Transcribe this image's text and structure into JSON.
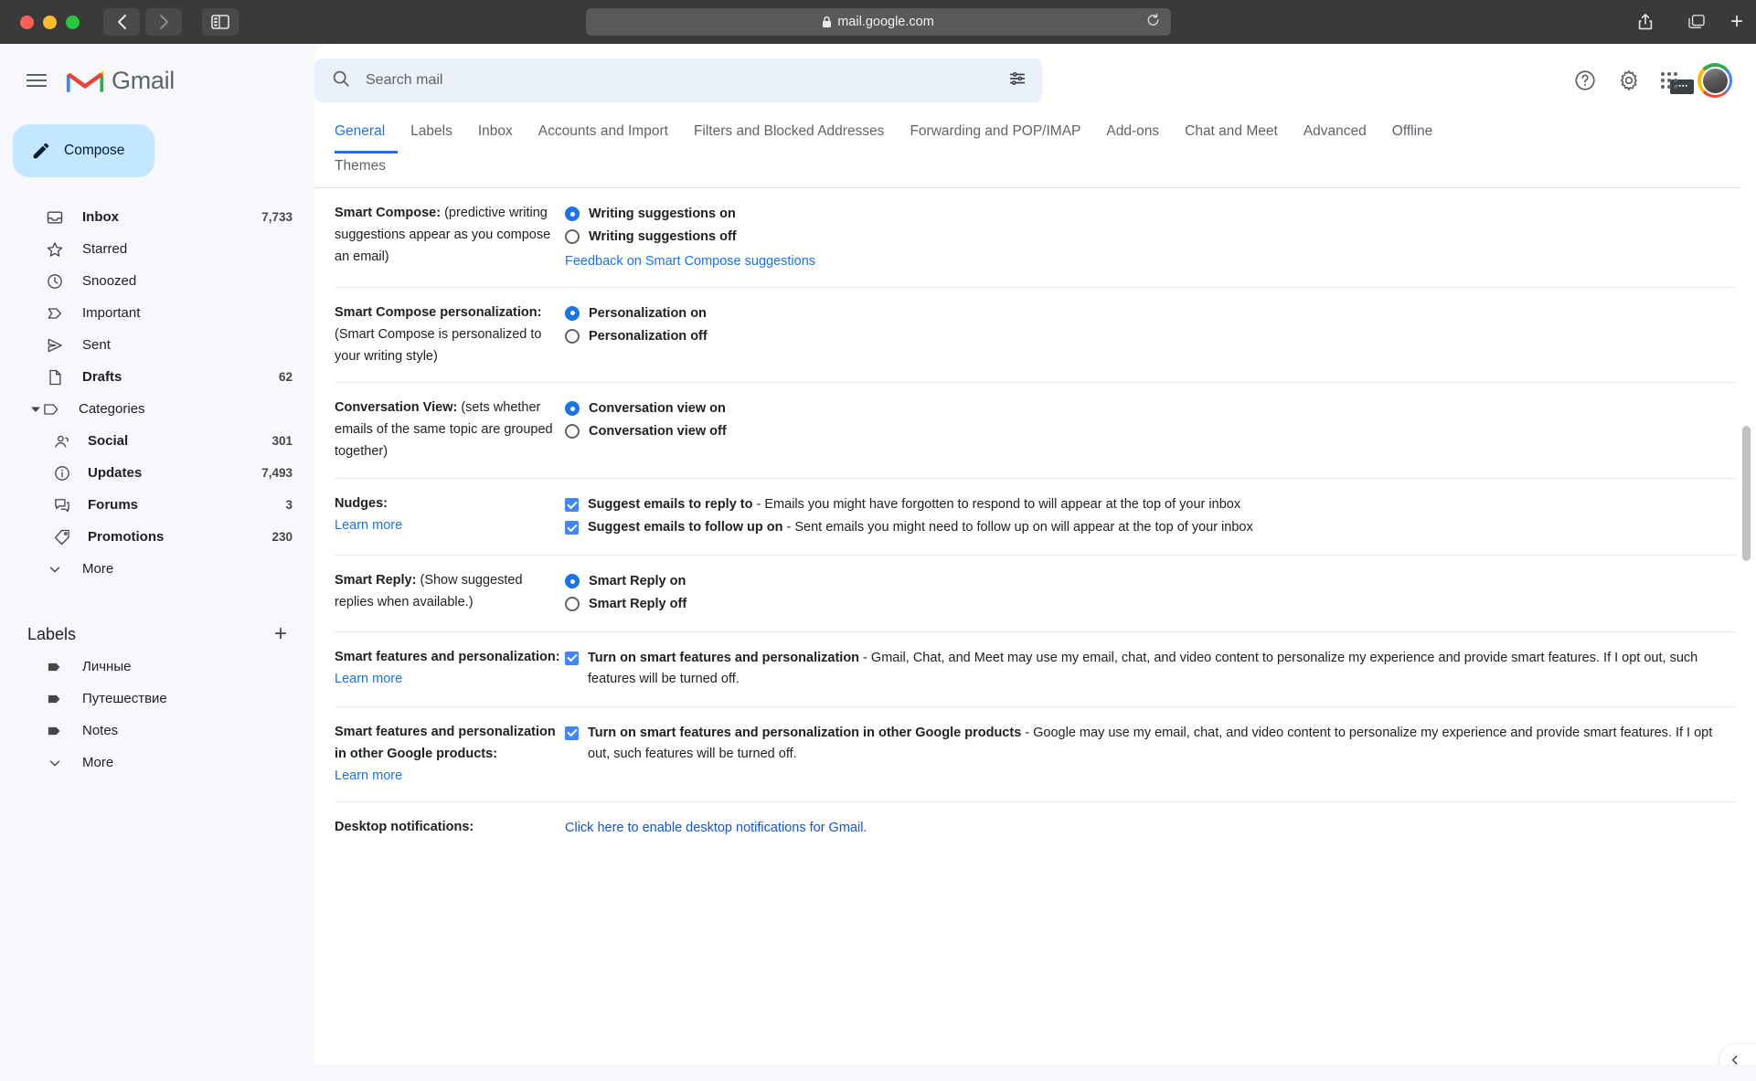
{
  "browser": {
    "url": "mail.google.com",
    "lock_icon": "lock-icon",
    "back_icon": "chevron-left-icon",
    "forward_icon": "chevron-right-icon",
    "sidebar_icon": "sidebar-toggle-icon",
    "share_icon": "share-icon",
    "tabs_icon": "tab-overview-icon",
    "new_tab_icon": "plus-icon",
    "reload_icon": "reload-icon"
  },
  "app": {
    "brand": "Gmail",
    "menu_icon": "hamburger-icon",
    "compose_label": "Compose",
    "compose_icon": "pencil-icon"
  },
  "search": {
    "placeholder": "Search mail",
    "search_icon": "search-icon",
    "options_icon": "search-options-icon"
  },
  "header": {
    "help_icon": "help-icon",
    "settings_icon": "gear-icon",
    "apps_icon": "app-grid-icon",
    "avatar": "avatar"
  },
  "sidebar": {
    "items": [
      {
        "label": "Inbox",
        "count": "7,733",
        "icon": "inbox-icon",
        "bold": true
      },
      {
        "label": "Starred",
        "count": "",
        "icon": "star-icon",
        "bold": false
      },
      {
        "label": "Snoozed",
        "count": "",
        "icon": "clock-icon",
        "bold": false
      },
      {
        "label": "Important",
        "count": "",
        "icon": "important-marker-icon",
        "bold": false
      },
      {
        "label": "Sent",
        "count": "",
        "icon": "send-icon",
        "bold": false
      },
      {
        "label": "Drafts",
        "count": "62",
        "icon": "draft-file-icon",
        "bold": true
      },
      {
        "label": "Categories",
        "count": "",
        "icon": "label-tag-icon",
        "bold": false,
        "expandable": true
      },
      {
        "label": "Social",
        "count": "301",
        "icon": "people-icon",
        "bold": true,
        "sub": true
      },
      {
        "label": "Updates",
        "count": "7,493",
        "icon": "info-icon",
        "bold": true,
        "sub": true
      },
      {
        "label": "Forums",
        "count": "3",
        "icon": "forum-icon",
        "bold": true,
        "sub": true
      },
      {
        "label": "Promotions",
        "count": "230",
        "icon": "price-tag-icon",
        "bold": true,
        "sub": true
      },
      {
        "label": "More",
        "count": "",
        "icon": "chevron-down-icon",
        "bold": false
      }
    ],
    "labels_title": "Labels",
    "add_label_icon": "plus-icon",
    "labels": [
      {
        "label": "Личные",
        "icon": "label-icon"
      },
      {
        "label": "Путешествие",
        "icon": "label-icon"
      },
      {
        "label": "Notes",
        "icon": "label-icon"
      },
      {
        "label": "More",
        "icon": "chevron-down-icon"
      }
    ]
  },
  "settings": {
    "title": "Settings",
    "keyboard_icon": "keyboard-icon",
    "keyboard_caret_icon": "chevron-down-icon",
    "tabs_row1": [
      "General",
      "Labels",
      "Inbox",
      "Accounts and Import",
      "Filters and Blocked Addresses",
      "Forwarding and POP/IMAP",
      "Add-ons",
      "Chat and Meet",
      "Advanced",
      "Offline"
    ],
    "tabs_row2": [
      "Themes"
    ],
    "active_tab": "General",
    "rows": [
      {
        "title": "Smart Compose:",
        "desc": "(predictive writing suggestions appear as you compose an email)",
        "type": "radio",
        "options": [
          {
            "label": "Writing suggestions on",
            "selected": true
          },
          {
            "label": "Writing suggestions off",
            "selected": false
          }
        ],
        "link": "Feedback on Smart Compose suggestions"
      },
      {
        "title": "Smart Compose personalization:",
        "desc": "(Smart Compose is personalized to your writing style)",
        "type": "radio",
        "options": [
          {
            "label": "Personalization on",
            "selected": true
          },
          {
            "label": "Personalization off",
            "selected": false
          }
        ]
      },
      {
        "title": "Conversation View:",
        "desc": "(sets whether emails of the same topic are grouped together)",
        "type": "radio",
        "options": [
          {
            "label": "Conversation view on",
            "selected": true
          },
          {
            "label": "Conversation view off",
            "selected": false
          }
        ]
      },
      {
        "title": "Nudges:",
        "learn_more": "Learn more",
        "type": "checkbox",
        "options": [
          {
            "label": "Suggest emails to reply to",
            "desc": " - Emails you might have forgotten to respond to will appear at the top of your inbox",
            "checked": true
          },
          {
            "label": "Suggest emails to follow up on",
            "desc": " - Sent emails you might need to follow up on will appear at the top of your inbox",
            "checked": true
          }
        ]
      },
      {
        "title": "Smart Reply:",
        "desc": "(Show suggested replies when available.)",
        "type": "radio",
        "options": [
          {
            "label": "Smart Reply on",
            "selected": true
          },
          {
            "label": "Smart Reply off",
            "selected": false
          }
        ]
      },
      {
        "title": "Smart features and personalization:",
        "learn_more": "Learn more",
        "type": "checkbox",
        "options": [
          {
            "label": "Turn on smart features and personalization",
            "desc": " - Gmail, Chat, and Meet may use my email, chat, and video content to personalize my experience and provide smart features. If I opt out, such features will be turned off.",
            "checked": true
          }
        ]
      },
      {
        "title": "Smart features and personalization in other Google products:",
        "learn_more": "Learn more",
        "type": "checkbox",
        "options": [
          {
            "label": "Turn on smart features and personalization in other Google products",
            "desc": " - Google may use my email, chat, and video content to personalize my experience and provide smart features. If I opt out, such features will be turned off.",
            "checked": true
          }
        ]
      },
      {
        "title": "Desktop notifications:",
        "type": "link",
        "link_text": "Click here to enable desktop notifications for Gmail."
      }
    ]
  },
  "colors": {
    "accent": "#1a73e8",
    "compose_bg": "#c2e7ff",
    "search_bg": "#eaf1fb",
    "rail_bg": "#f6f8fc",
    "checkbox": "#4285f4"
  }
}
